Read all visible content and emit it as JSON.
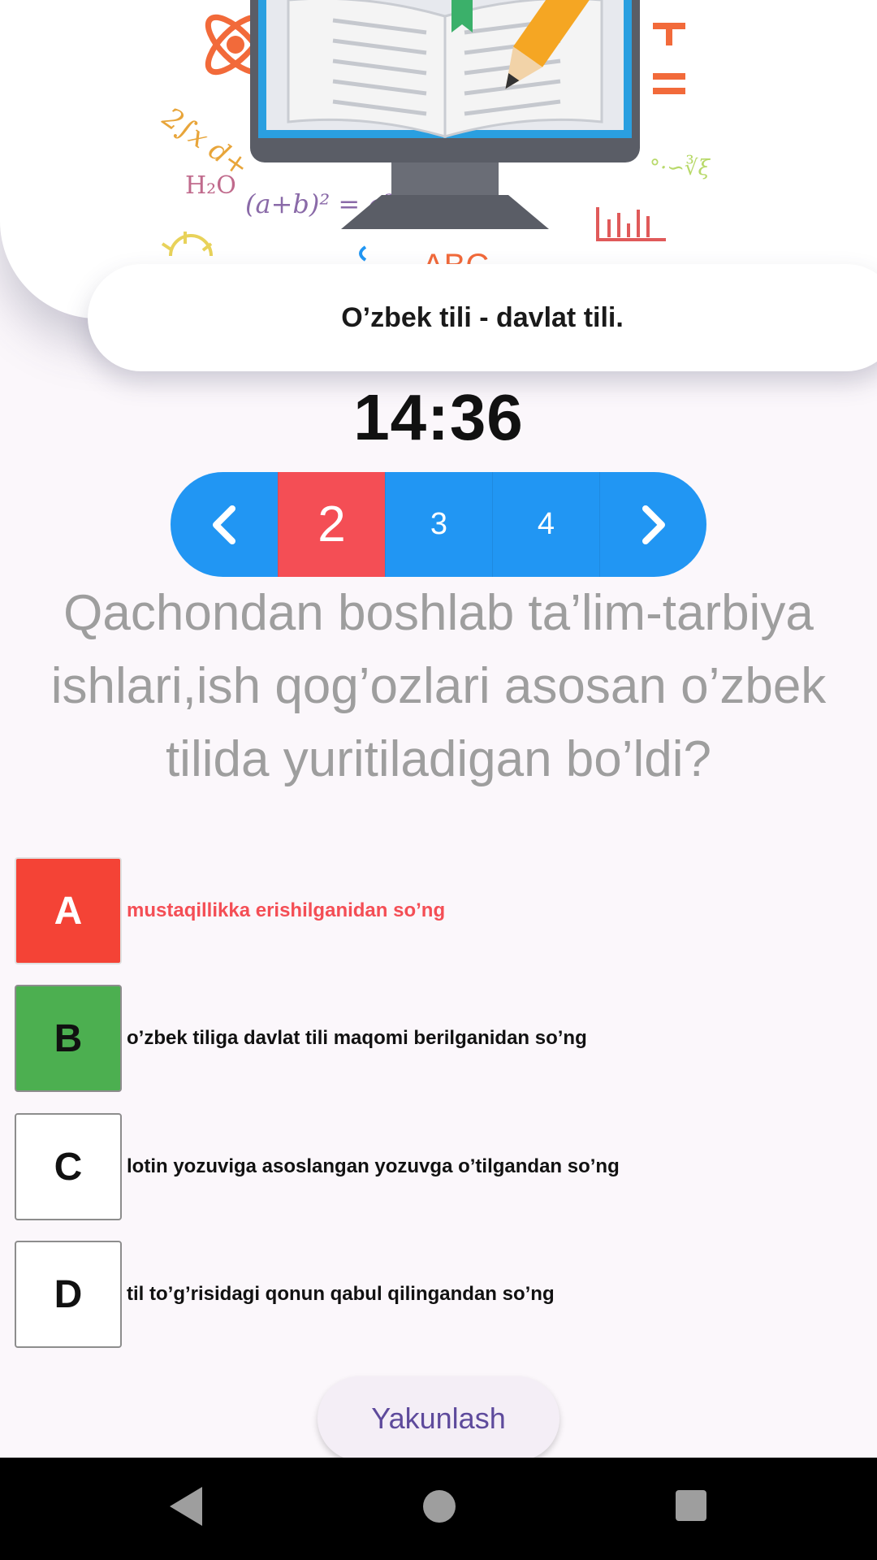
{
  "header": {
    "topic": "O’zbek tili - davlat tili.",
    "illustration": {
      "formulas": [
        "ƒx d+",
        "H₂O",
        "(a+b)² = a²",
        "+",
        "="
      ]
    }
  },
  "timer": "14:36",
  "pager": {
    "prev_icon": "chevron-left-icon",
    "next_icon": "chevron-right-icon",
    "pages": [
      "2",
      "3",
      "4"
    ],
    "active_page": "2"
  },
  "question": "Qachondan boshlab ta’lim-tarbiya ishlari,ish qog’ozlari asosan o’zbek tilida yuritiladigan bo’ldi?",
  "options": [
    {
      "letter": "A",
      "text": "mustaqillikka erishilganidan so’ng",
      "state": "wrong",
      "color": "#f44336"
    },
    {
      "letter": "B",
      "text": "o’zbek tiliga davlat tili maqomi berilganidan so’ng",
      "state": "correct",
      "color": "#4caf50"
    },
    {
      "letter": "C",
      "text": "lotin yozuviga asoslangan yozuvga o’tilgandan so’ng",
      "state": "neutral"
    },
    {
      "letter": "D",
      "text": "til to’g’risidagi qonun qabul qilingandan so’ng",
      "state": "neutral"
    }
  ],
  "finish_button": "Yakunlash",
  "system_nav": {
    "back_icon": "back-triangle-icon",
    "home_icon": "home-circle-icon",
    "recents_icon": "recents-square-icon"
  },
  "colors": {
    "accent_blue": "#2196f3",
    "active_red": "#f44e55",
    "wrong_red": "#f44336",
    "correct_green": "#4caf50",
    "button_text": "#5e4a9c"
  }
}
